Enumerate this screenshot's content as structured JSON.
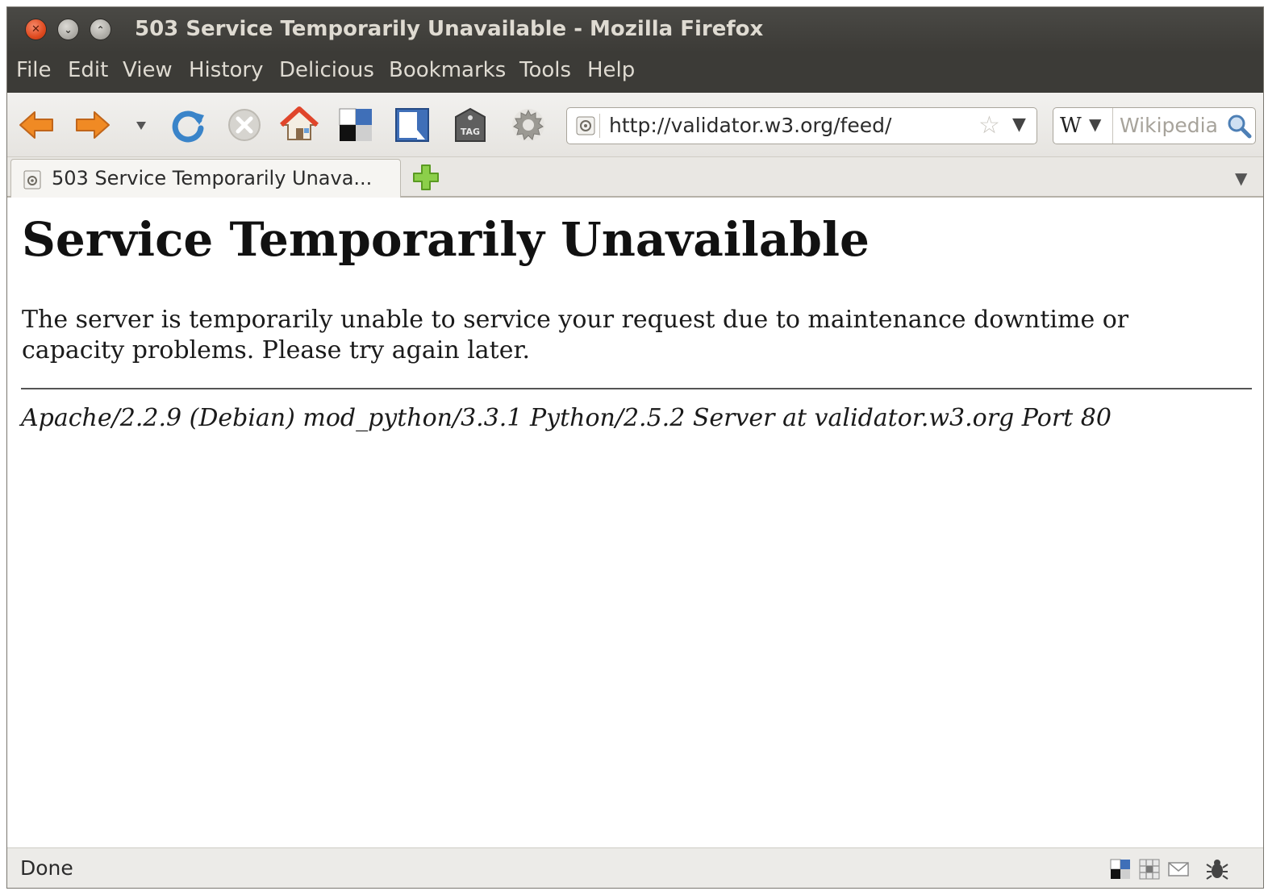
{
  "window": {
    "title": "503 Service Temporarily Unavailable - Mozilla Firefox"
  },
  "menubar": {
    "items": [
      "File",
      "Edit",
      "View",
      "History",
      "Delicious",
      "Bookmarks",
      "Tools",
      "Help"
    ]
  },
  "navbar": {
    "url": "http://validator.w3.org/feed/",
    "search_placeholder": "Wikipedia",
    "search_engine": "W",
    "icons": [
      "back-icon",
      "forward-icon",
      "history-dropdown-icon",
      "reload-icon",
      "stop-icon",
      "home-icon",
      "delicious-icon",
      "bookmark-icon",
      "tag-icon",
      "gear-icon"
    ]
  },
  "tabs": [
    {
      "label": "503 Service Temporarily Unava...",
      "active": true
    }
  ],
  "page": {
    "heading": "Service Temporarily Unavailable",
    "message": "The server is temporarily unable to service your request due to maintenance downtime or capacity problems. Please try again later.",
    "server_signature": "Apache/2.2.9 (Debian) mod_python/3.3.1 Python/2.5.2 Server at validator.w3.org Port 80"
  },
  "statusbar": {
    "text": "Done",
    "icons": [
      "delicious-status-icon",
      "extension-status-icon",
      "mail-icon",
      "firebug-icon"
    ]
  },
  "colors": {
    "titlebar": "#3c3b37",
    "close_button": "#df4a1f",
    "arrow_orange": "#f08a24",
    "reload_blue": "#3a84c9"
  }
}
